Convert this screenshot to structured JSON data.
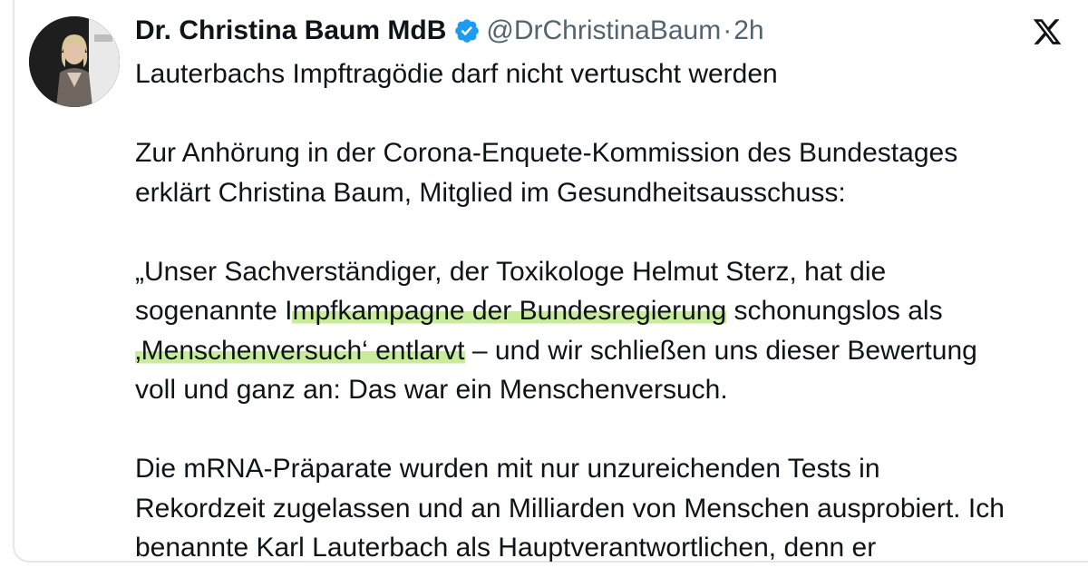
{
  "author": {
    "name": "Dr. Christina Baum MdB",
    "handle": "@DrChristinaBaum",
    "separator": "·",
    "time": "2h"
  },
  "icons": {
    "verified": "verified-badge-icon",
    "platform": "x-logo-icon"
  },
  "colors": {
    "verified_blue": "#1d9bf0",
    "text": "#0f1419",
    "muted": "#536471",
    "highlight": "#c9ec9b"
  },
  "tweet": {
    "title": "Lauterbachs Impftragödie darf nicht vertuscht werden",
    "para1_line1": "Zur Anhörung in der Corona-Enquete-Kommission des Bundestages",
    "para1_line2": "erklärt Christina Baum, Mitglied im Gesundheitsausschuss:",
    "para2_line1": "„Unser Sachverständiger, der Toxikologe Helmut Sterz, hat die",
    "para2_line2_pre": "sogenannte I",
    "para2_line2_hl": "mpfkampagne der Bundesregierung",
    "para2_line2_post": " schonungslos als",
    "para2_line3_hl": "‚Menschenversuch‘ entlarvt",
    "para2_line3_post": " – und wir schließen uns dieser Bewertung",
    "para2_line4": "voll und ganz an: Das war ein Menschenversuch.",
    "para3_line1": "Die mRNA-Präparate wurden mit nur unzureichenden Tests in",
    "para3_line2": "Rekordzeit zugelassen und an Milliarden von Menschen ausprobiert. Ich",
    "para3_line3": "benannte Karl Lauterbach als Hauptverantwortlichen, denn er"
  }
}
